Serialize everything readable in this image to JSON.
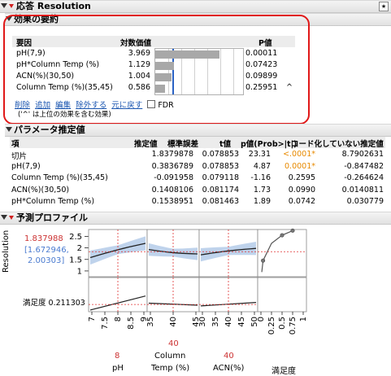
{
  "report": {
    "title": "応答 Resolution"
  },
  "effects": {
    "title": "効果の要約",
    "col_source": "要因",
    "col_logworth": "対数価値",
    "col_pvalue": "P値",
    "rows": [
      {
        "name": "pH(7,9)",
        "logworth": "3.969",
        "pvalue": "0.00011",
        "mark": "",
        "bar": 3.969
      },
      {
        "name": "pH*Column Temp (%)",
        "logworth": "1.129",
        "pvalue": "0.07423",
        "mark": "",
        "bar": 1.129
      },
      {
        "name": "ACN(%)(30,50)",
        "logworth": "1.004",
        "pvalue": "0.09899",
        "mark": "",
        "bar": 1.004
      },
      {
        "name": "Column Temp (%)(35,45)",
        "logworth": "0.586",
        "pvalue": "0.25951",
        "mark": "^",
        "bar": 0.586
      }
    ],
    "actions": [
      "削除",
      "追加",
      "編集",
      "除外する",
      "元に戻す"
    ],
    "fdr_label": "FDR",
    "footnote": "('^' は上位の効果を含む効果)"
  },
  "params": {
    "title": "パラメータ推定値",
    "headers": [
      "項",
      "推定値",
      "標準誤差",
      "t値",
      "p値(Prob>|t|)",
      "コード化していない推定値"
    ],
    "rows": [
      [
        "切片",
        "1.8379878",
        "0.078853",
        "23.31",
        "<.0001*",
        "8.7902631"
      ],
      [
        "pH(7,9)",
        "0.3836789",
        "0.078853",
        "4.87",
        "0.0001*",
        "-0.847482"
      ],
      [
        "Column Temp (%)(35,45)",
        "-0.091958",
        "0.079118",
        "-1.16",
        "0.2595",
        "-0.264624"
      ],
      [
        "ACN(%)(30,50)",
        "0.1408106",
        "0.081174",
        "1.73",
        "0.0990",
        "0.0140811"
      ],
      [
        "pH*Column Temp (%)",
        "0.1538951",
        "0.081463",
        "1.89",
        "0.0742",
        "0.030779"
      ]
    ]
  },
  "profiler": {
    "title": "予測プロファイル",
    "response_label": "Resolution",
    "pred_value": "1.837988",
    "ci_line1": "[1.672946,",
    "ci_line2": "2.00303]",
    "desirability_label": "満足度 0.211303",
    "top_ticks": [
      "2.5",
      "2",
      "1.5",
      "1"
    ],
    "factors": [
      {
        "value": "8",
        "name": "pH",
        "ticks": [
          "7",
          "7.5",
          "8",
          "8.5",
          "9"
        ]
      },
      {
        "value": "40",
        "name_line1": "Column",
        "name_line2": "Temp (%)",
        "ticks": [
          "35",
          "40",
          "45"
        ]
      },
      {
        "value": "40",
        "name": "ACN(%)",
        "ticks": [
          "30",
          "35",
          "40",
          "45",
          "50"
        ]
      }
    ],
    "desir_ticks": [
      "0",
      "0.25",
      "0.5",
      "0.75",
      "1"
    ],
    "desir_axis_label": "満足度",
    "colors": {
      "crosshair": "#e03030",
      "band": "#a9c4e6",
      "line": "#222222",
      "desir_point": "#777777"
    }
  }
}
